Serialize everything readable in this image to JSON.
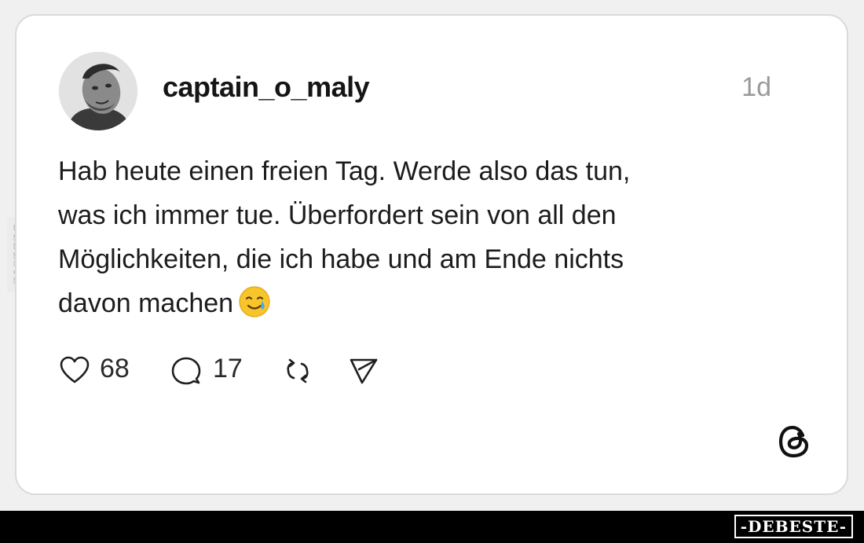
{
  "post": {
    "username": "captain_o_maly",
    "timestamp": "1d",
    "text_lines": [
      "Hab heute einen freien Tag. Werde also das tun,",
      "was ich immer tue. Überfordert sein von all den",
      "Möglichkeiten, die ich habe und am Ende nichts",
      "davon machen"
    ],
    "emoji": "smiling-face-with-tear",
    "likes_count": "68",
    "replies_count": "17"
  },
  "icons": {
    "like": "heart-icon",
    "reply": "comment-bubble-icon",
    "repost": "repost-icon",
    "share": "send-icon",
    "brand": "threads-logo-icon"
  },
  "watermarks": {
    "side": "DEBESTE",
    "bottom": "-DEBESTE-"
  },
  "colors": {
    "card_background": "#ffffff",
    "card_border": "#dadada",
    "page_background": "#f0f0f0",
    "username": "#151515",
    "timestamp": "#9a9a9a",
    "bottom_bar": "#000000"
  }
}
